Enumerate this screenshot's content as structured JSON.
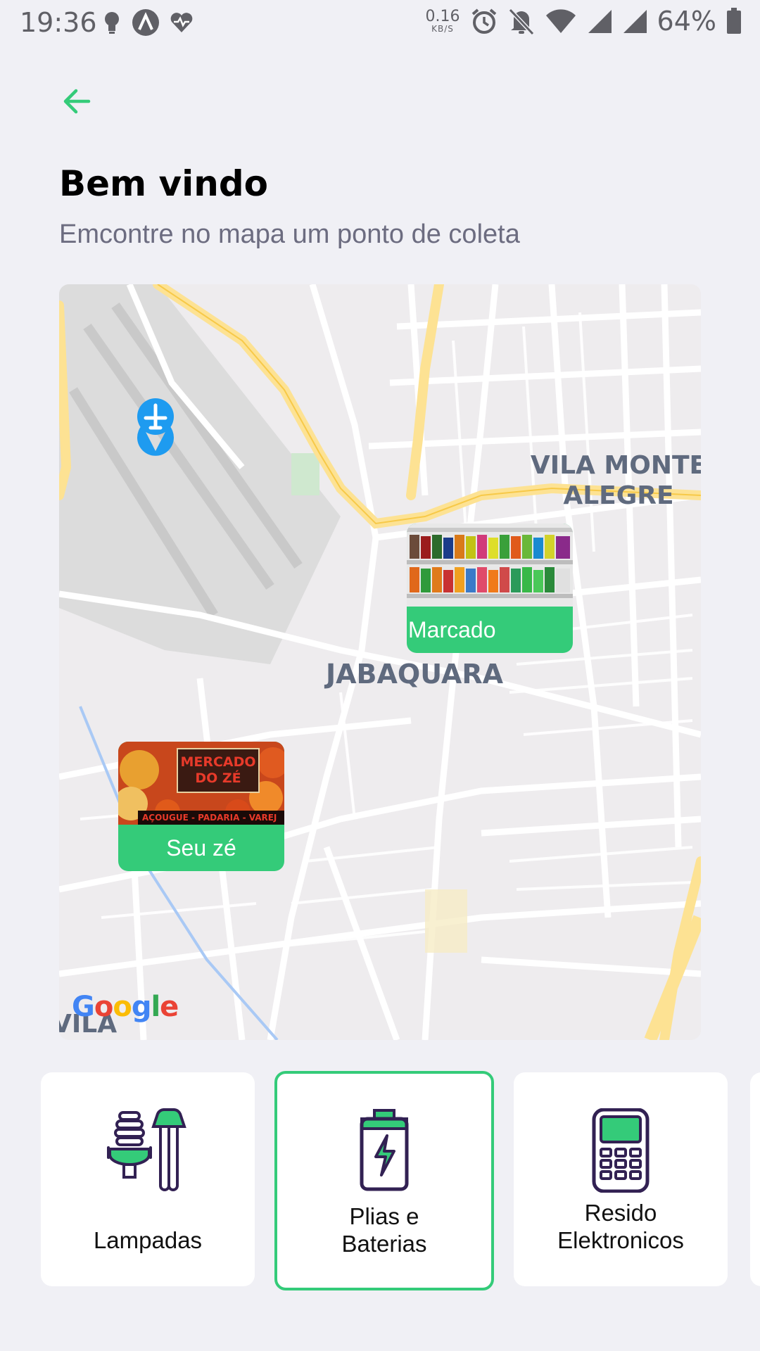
{
  "status_bar": {
    "time": "19:36",
    "net_speed": "0.16",
    "net_unit": "KB/S",
    "battery": "64%",
    "left_icons": [
      "lightbulb-icon",
      "app-a-icon",
      "heart-rate-icon"
    ],
    "right_icons": [
      "alarm-icon",
      "mute-icon",
      "wifi-icon",
      "signal-icon",
      "signal-icon",
      "battery-icon"
    ]
  },
  "header": {
    "back_icon": "arrow-left-icon",
    "title": "Bem vindo",
    "subtitle": "Emcontre no mapa um ponto de coleta"
  },
  "map": {
    "places": [
      "VILA MONTE ALEGRE",
      "JABAQUARA",
      "VILA SANTA"
    ],
    "airport_icon": "airport-icon",
    "attribution": "Google",
    "markers": [
      {
        "name": "Marcado",
        "image": "store-shelves-image"
      },
      {
        "name": "Seu zé",
        "image": "mercado-do-ze-image",
        "sign_title": "MERCADO DO ZÉ",
        "sign_subtitle": "AÇOUGUE - PADARIA - VAREJ"
      }
    ]
  },
  "items": [
    {
      "title": "Lampadas",
      "icon": "lamp-icon",
      "selected": false
    },
    {
      "title_line1": "Plias e",
      "title_line2": "Baterias",
      "icon": "battery-icon",
      "selected": true
    },
    {
      "title_line1": "Resido",
      "title_line2": "Elektronicos",
      "icon": "electronics-icon",
      "selected": false
    }
  ],
  "colors": {
    "background": "#f0f0f5",
    "accent": "#34cb79",
    "dark_purple": "#322153",
    "subtitle": "#6c6c80",
    "map_road_major": "#fde293",
    "map_label": "#5f6a7e"
  }
}
